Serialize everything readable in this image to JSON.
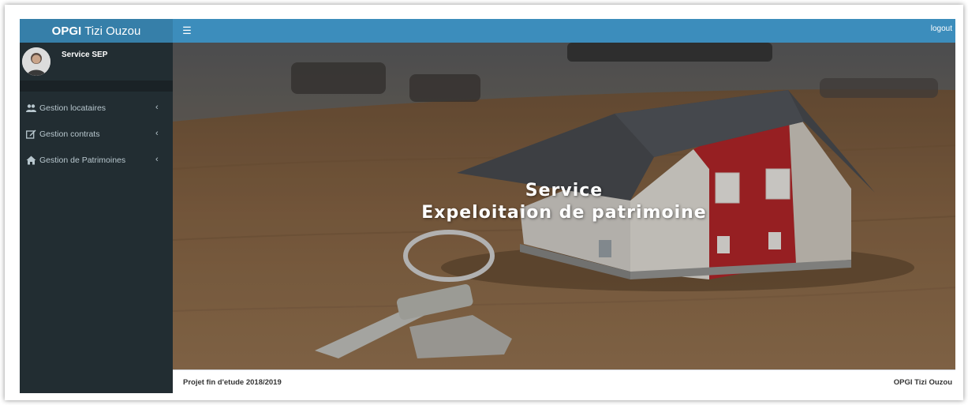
{
  "header": {
    "logo_bold": "OPGI",
    "logo_text": "Tizi Ouzou",
    "toggle_icon": "hamburger-icon",
    "logout_label": "logout"
  },
  "sidebar": {
    "user_name": "Service SEP",
    "items": [
      {
        "label": "Gestion locataires",
        "icon": "users-icon"
      },
      {
        "label": "Gestion contrats",
        "icon": "edit-icon"
      },
      {
        "label": "Gestion de Patrimoines",
        "icon": "home-icon"
      }
    ],
    "chevron": "‹"
  },
  "hero": {
    "title_line1": "Service",
    "title_line2": "Expeloitaion de patrimoine"
  },
  "footer": {
    "left": "Projet fin d'etude 2018/2019",
    "right": "OPGI Tizi Ouzou"
  },
  "colors": {
    "header": "#3c8dbc",
    "logo_bg": "#367fa9",
    "sidebar": "#222d32",
    "sidebar_text": "#b8c7ce"
  }
}
